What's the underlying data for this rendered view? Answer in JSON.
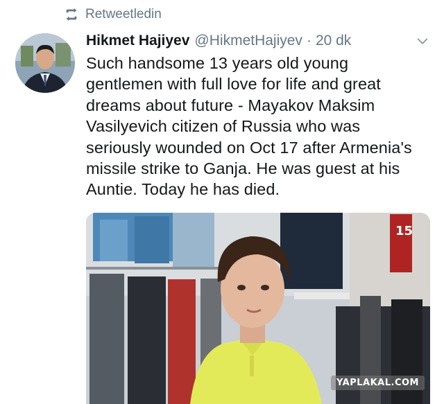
{
  "retweet": {
    "icon": "retweet-icon",
    "label": "Retweetledin"
  },
  "tweet": {
    "author_name": "Hikmet Hajiyev",
    "handle": "@HikmetHajiyev",
    "separator": "·",
    "time": "20 dk",
    "menu_icon": "chevron-down-icon",
    "text": "Such handsome 13 years old young\ngentlemen with full love for life and great\ndreams about future - Mayakov Maksim\nVasilyevich citizen of Russia who was\nseriously wounded on Oct 17 after Armenia's\nmissile strike to Ganja. He was guest at his\nAuntie. Today he has died."
  },
  "media": {
    "watermark": "YAPLAKAL.COM",
    "sign_text": "15"
  },
  "colors": {
    "text": "#14171a",
    "secondary": "#657786",
    "shirt": "#e3ea5a"
  }
}
